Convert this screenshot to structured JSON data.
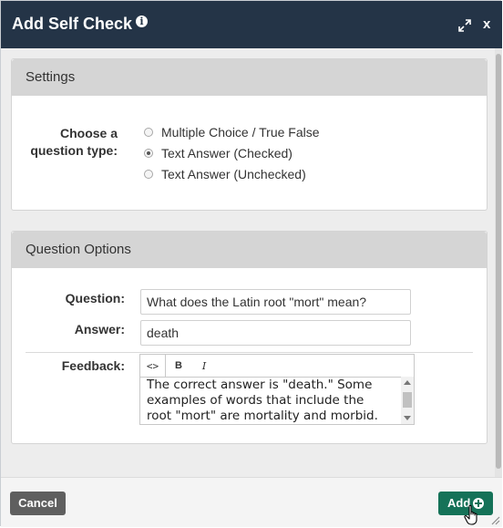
{
  "dialog": {
    "title": "Add Self Check",
    "info_icon": "info-icon",
    "expand_icon": "expand-icon",
    "close_label": "x"
  },
  "settings": {
    "heading": "Settings",
    "question_type_label_line1": "Choose a",
    "question_type_label_line2": "question type:",
    "options": [
      {
        "label": "Multiple Choice / True False",
        "checked": false
      },
      {
        "label": "Text Answer (Checked)",
        "checked": true
      },
      {
        "label": "Text Answer (Unchecked)",
        "checked": false
      }
    ]
  },
  "question_options": {
    "heading": "Question Options",
    "question_label": "Question:",
    "question_value": "What does the Latin root \"mort\" mean?",
    "answer_label": "Answer:",
    "answer_value": "death",
    "feedback_label": "Feedback:",
    "toolbar": {
      "source_glyph": "<>",
      "bold_glyph": "B",
      "italic_glyph": "I"
    },
    "feedback_lines": [
      "The correct answer is \"death.\" Some",
      "examples of words that include the",
      "root \"mort\" are mortality and morbid."
    ]
  },
  "footer": {
    "cancel_label": "Cancel",
    "add_label": "Add"
  },
  "colors": {
    "titlebar": "#243447",
    "add_button": "#157258",
    "cancel_button": "#5f5f5f"
  }
}
